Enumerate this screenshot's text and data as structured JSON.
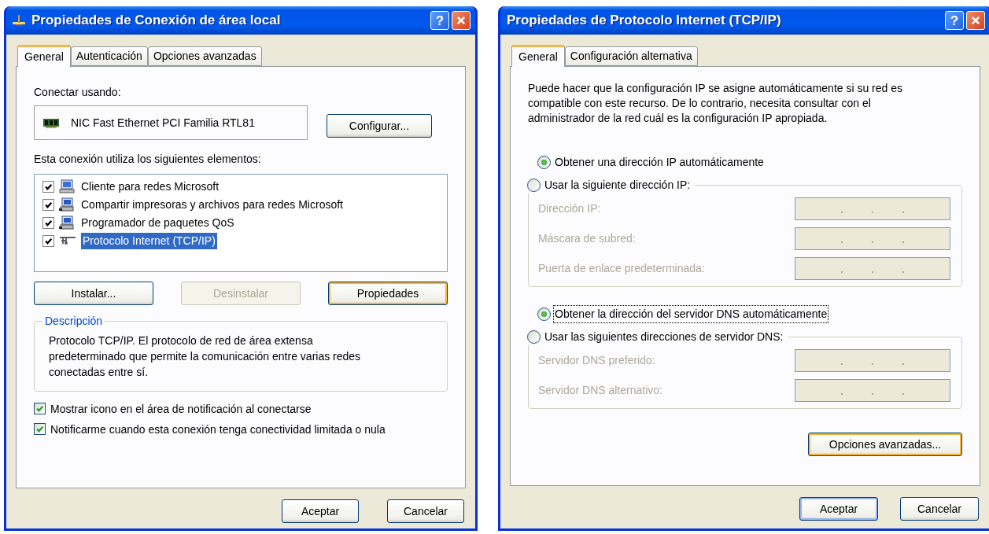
{
  "connection_dialog": {
    "title": "Propiedades de Conexión de área local",
    "help_button": "?",
    "tabs": [
      {
        "label": "General",
        "selected": true
      },
      {
        "label": "Autenticación",
        "selected": false
      },
      {
        "label": "Opciones avanzadas",
        "selected": false
      }
    ],
    "connect_using_label": "Conectar usando:",
    "adapter": "NIC Fast Ethernet PCI Familia RTL81",
    "configure_button": "Configurar...",
    "components_label": "Esta conexión utiliza los siguientes elementos:",
    "components": [
      {
        "kind": "client",
        "label": "Cliente para redes Microsoft",
        "checked": true,
        "selected": false
      },
      {
        "kind": "service",
        "label": "Compartir impresoras y archivos para redes Microsoft",
        "checked": true,
        "selected": false
      },
      {
        "kind": "service",
        "label": "Programador de paquetes QoS",
        "checked": true,
        "selected": false
      },
      {
        "kind": "protocol",
        "label": "Protocolo Internet (TCP/IP)",
        "checked": true,
        "selected": true
      }
    ],
    "component_buttons": [
      {
        "label": "Instalar...",
        "disabled": false,
        "focused": false
      },
      {
        "label": "Desinstalar",
        "disabled": true,
        "focused": false
      },
      {
        "label": "Propiedades",
        "disabled": false,
        "focused": true
      }
    ],
    "description": {
      "legend": "Descripción",
      "text": "Protocolo TCP/IP. El protocolo de red de área extensa predeterminado que permite la comunicación entre varias redes conectadas entre sí."
    },
    "options": [
      {
        "label": "Mostrar icono en el área de notificación al conectarse",
        "checked": true
      },
      {
        "label": "Notificarme cuando esta conexión tenga conectividad limitada o nula",
        "checked": true
      }
    ],
    "footer_buttons": [
      {
        "label": "Aceptar",
        "default": false
      },
      {
        "label": "Cancelar",
        "default": false
      }
    ]
  },
  "tcpip_dialog": {
    "title": "Propiedades de Protocolo Internet (TCP/IP)",
    "help_button": "?",
    "tabs": [
      {
        "label": "General",
        "selected": true
      },
      {
        "label": "Configuración alternativa",
        "selected": false
      }
    ],
    "intro": "Puede hacer que la configuración IP se asigne automáticamente si su red es compatible con este recurso. De lo contrario, necesita consultar con el administrador de la red cuál es la configuración IP apropiada.",
    "ip_options": [
      {
        "label": "Obtener una dirección IP automáticamente",
        "selected": true,
        "focused": false
      },
      {
        "label": "Usar la siguiente dirección IP:",
        "selected": false,
        "focused": false
      }
    ],
    "ip_fields": [
      {
        "label": "Dirección IP:",
        "disabled": true
      },
      {
        "label": "Máscara de subred:",
        "disabled": true
      },
      {
        "label": "Puerta de enlace predeterminada:",
        "disabled": true
      }
    ],
    "dns_options": [
      {
        "label": "Obtener la dirección del servidor DNS automáticamente",
        "selected": true,
        "focused": true
      },
      {
        "label": "Usar las siguientes direcciones de servidor DNS:",
        "selected": false,
        "focused": false
      }
    ],
    "dns_fields": [
      {
        "label": "Servidor DNS preferido:",
        "disabled": true
      },
      {
        "label": "Servidor DNS alternativo:",
        "disabled": true
      }
    ],
    "advanced_button": {
      "label": "Opciones avanzadas...",
      "focused": true
    },
    "footer_buttons": [
      {
        "label": "Aceptar",
        "default": true
      },
      {
        "label": "Cancelar",
        "default": false
      }
    ]
  }
}
